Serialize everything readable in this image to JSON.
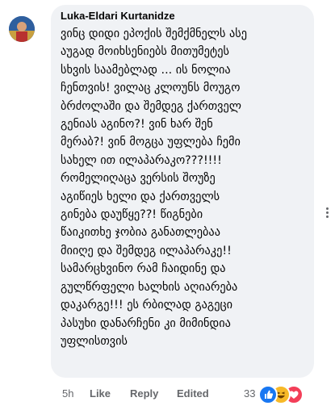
{
  "comment": {
    "author": "Luka-Eldari Kurtanidze",
    "text": "ვინც დიდი ეპოქის შემქმნელს ასე\nაუგად მოიხსენიებს მითუმეტეს\nსხვის საამებლად ... ის ნოლია\nჩენთვის! ვილაც კლოუნს მოუგო\nბრძოლაში და შემდეგ ქართველ\nგენიას აგინო?! ვინ ხარ შენ\nმერაბ?! ვინ მოგცა უფლება ჩემი\nსახელ ით ილაპარაკო???!!!!\nრომელიღაცა ვერსის შოუზე\nაგიწიეს ხელი და ქართველს\nგინება დაუწყე??! წიგნები\nწაიკითხე ჯობია განათლებაა\nმიიღე და შემდეგ ილაპარაკე!!\nსამარცხვინო რამ ჩაიდინე და\nგულწრფელი ხალხის აღიარება\nდაკარგე!!! ეს რბილად გაგეცი\nპასუხი დანარჩენი კი მიმინდია\nუფლისთვის"
  },
  "footer": {
    "time": "5h",
    "like_label": "Like",
    "reply_label": "Reply",
    "edited_label": "Edited"
  },
  "reactions": {
    "count": "33",
    "icons": [
      "like-reaction-icon",
      "haha-reaction-icon",
      "love-reaction-icon"
    ]
  },
  "colors": {
    "bubble": "#f0f2f5",
    "secondary_text": "#65676b",
    "like_blue": "#1877f2",
    "haha_yellow": "#f7b928",
    "love_red": "#f33e58"
  }
}
